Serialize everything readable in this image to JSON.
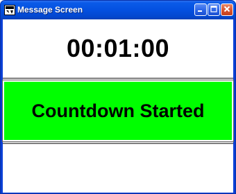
{
  "window": {
    "title": "Message Screen",
    "controls": {
      "minimize_icon": "minimize-icon",
      "maximize_icon": "maximize-icon",
      "close_icon": "close-icon"
    }
  },
  "display": {
    "time": "00:01:00",
    "status": "Countdown Started",
    "status_color": "#00ff00"
  }
}
